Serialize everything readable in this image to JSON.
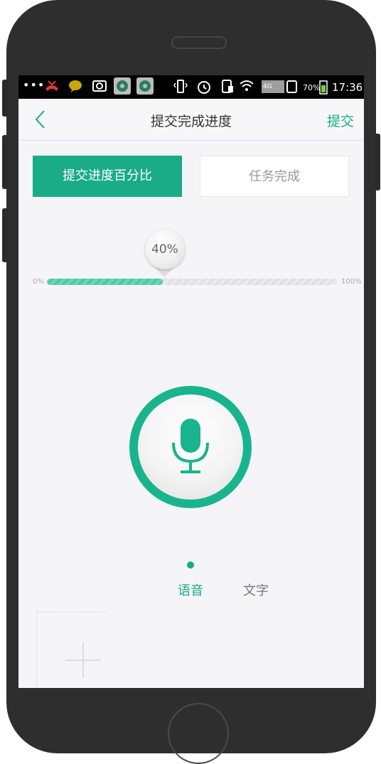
{
  "status_bar": {
    "dots": "•••",
    "battery_percent": "70%",
    "network": "4G",
    "time": "17:36",
    "icons": [
      "missed-call-icon",
      "chat-bubble-icon",
      "screenshot-icon",
      "app-icon",
      "app-icon",
      "vibrate-icon",
      "alarm-icon",
      "sim-icon",
      "wifi-icon",
      "signal-icon",
      "battery-icon"
    ]
  },
  "navbar": {
    "title": "提交完成进度",
    "submit_label": "提交"
  },
  "tabs": [
    {
      "label": "提交进度百分比",
      "active": true
    },
    {
      "label": "任务完成",
      "active": false
    }
  ],
  "progress": {
    "value": 40,
    "value_label": "40%",
    "min_label": "0%",
    "max_label": "100%"
  },
  "input_modes": [
    {
      "label": "语音",
      "active": true
    },
    {
      "label": "文字",
      "active": false
    }
  ],
  "colors": {
    "accent": "#1aab87",
    "background": "#f5f5f8"
  }
}
